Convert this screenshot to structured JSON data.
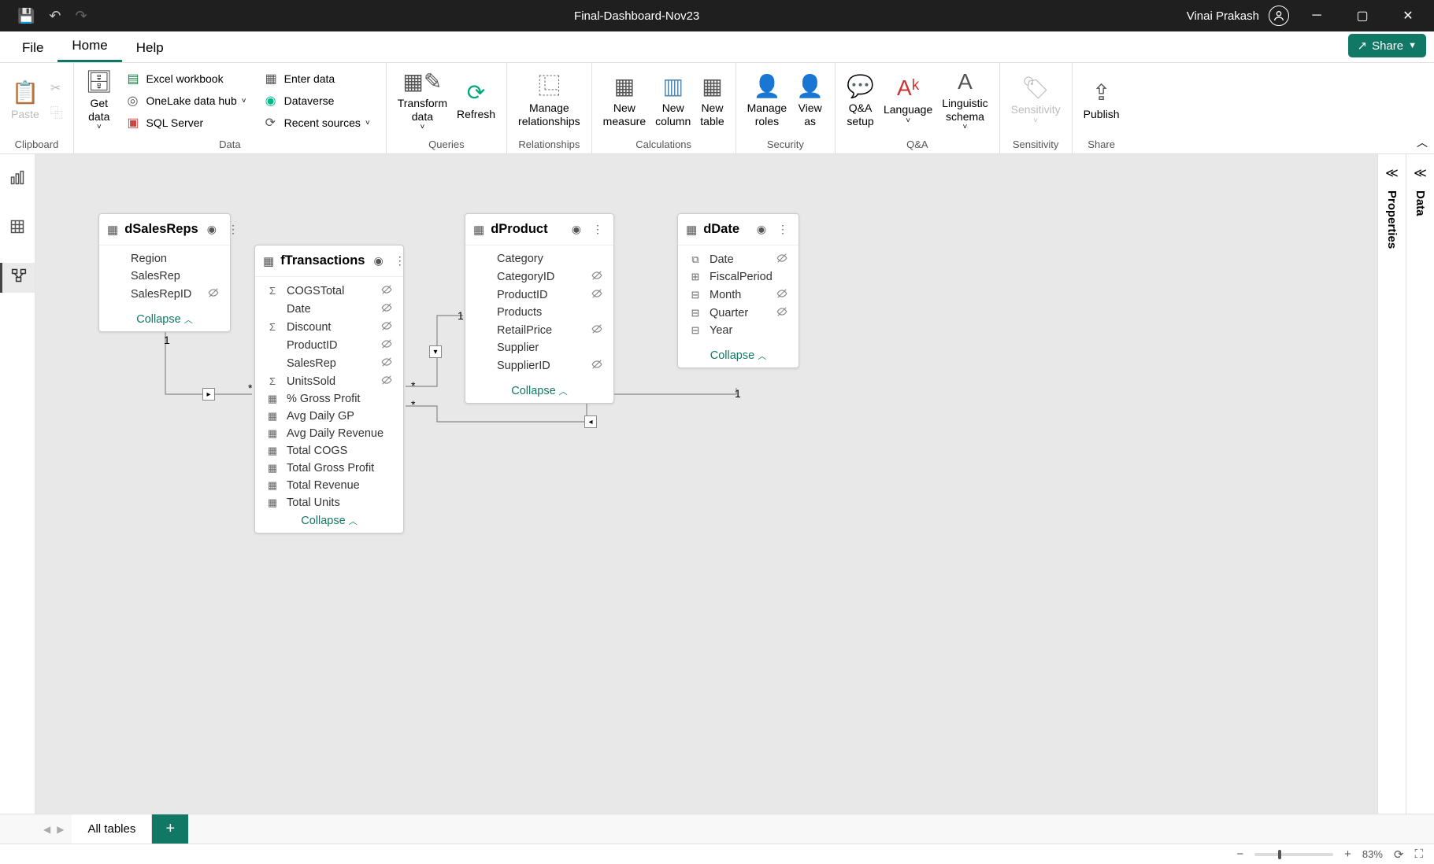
{
  "titlebar": {
    "title": "Final-Dashboard-Nov23",
    "user": "Vinai Prakash"
  },
  "menu": {
    "file": "File",
    "home": "Home",
    "help": "Help",
    "share": "Share"
  },
  "ribbon": {
    "clipboard": {
      "paste": "Paste",
      "label": "Clipboard"
    },
    "data": {
      "getdata": "Get\ndata",
      "excel": "Excel workbook",
      "onelake": "OneLake data hub",
      "sql": "SQL Server",
      "enterdata": "Enter data",
      "dataverse": "Dataverse",
      "recent": "Recent sources",
      "label": "Data"
    },
    "queries": {
      "transform": "Transform\ndata",
      "refresh": "Refresh",
      "label": "Queries"
    },
    "relationships": {
      "manage": "Manage\nrelationships",
      "label": "Relationships"
    },
    "calculations": {
      "measure": "New\nmeasure",
      "column": "New\ncolumn",
      "table": "New\ntable",
      "label": "Calculations"
    },
    "security": {
      "roles": "Manage\nroles",
      "viewas": "View\nas",
      "label": "Security"
    },
    "qa": {
      "setup": "Q&A\nsetup",
      "language": "Language",
      "schema": "Linguistic\nschema",
      "label": "Q&A"
    },
    "sensitivity": {
      "sens": "Sensitivity",
      "label": "Sensitivity"
    },
    "share": {
      "publish": "Publish",
      "label": "Share"
    }
  },
  "panels": {
    "data": "Data",
    "properties": "Properties"
  },
  "tables": {
    "dSalesReps": {
      "name": "dSalesReps",
      "fields": [
        {
          "name": "Region",
          "icon": "",
          "hidden": false
        },
        {
          "name": "SalesRep",
          "icon": "",
          "hidden": false
        },
        {
          "name": "SalesRepID",
          "icon": "",
          "hidden": true
        }
      ],
      "collapse": "Collapse"
    },
    "fTransactions": {
      "name": "fTransactions",
      "fields": [
        {
          "name": "COGSTotal",
          "icon": "Σ",
          "hidden": true
        },
        {
          "name": "Date",
          "icon": "",
          "hidden": true
        },
        {
          "name": "Discount",
          "icon": "Σ",
          "hidden": true
        },
        {
          "name": "ProductID",
          "icon": "",
          "hidden": true
        },
        {
          "name": "SalesRep",
          "icon": "",
          "hidden": true
        },
        {
          "name": "UnitsSold",
          "icon": "Σ",
          "hidden": true
        },
        {
          "name": "% Gross Profit",
          "icon": "▦",
          "hidden": false
        },
        {
          "name": "Avg Daily GP",
          "icon": "▦",
          "hidden": false
        },
        {
          "name": "Avg Daily Revenue",
          "icon": "▦",
          "hidden": false
        },
        {
          "name": "Total COGS",
          "icon": "▦",
          "hidden": false
        },
        {
          "name": "Total Gross Profit",
          "icon": "▦",
          "hidden": false
        },
        {
          "name": "Total Revenue",
          "icon": "▦",
          "hidden": false
        },
        {
          "name": "Total Units",
          "icon": "▦",
          "hidden": false
        }
      ],
      "collapse": "Collapse"
    },
    "dProduct": {
      "name": "dProduct",
      "fields": [
        {
          "name": "Category",
          "icon": "",
          "hidden": false
        },
        {
          "name": "CategoryID",
          "icon": "",
          "hidden": true
        },
        {
          "name": "ProductID",
          "icon": "",
          "hidden": true
        },
        {
          "name": "Products",
          "icon": "",
          "hidden": false
        },
        {
          "name": "RetailPrice",
          "icon": "",
          "hidden": true
        },
        {
          "name": "Supplier",
          "icon": "",
          "hidden": false
        },
        {
          "name": "SupplierID",
          "icon": "",
          "hidden": true
        }
      ],
      "collapse": "Collapse"
    },
    "dDate": {
      "name": "dDate",
      "fields": [
        {
          "name": "Date",
          "icon": "⧉",
          "hidden": true
        },
        {
          "name": "FiscalPeriod",
          "icon": "⊞",
          "hidden": false
        },
        {
          "name": "Month",
          "icon": "⊟",
          "hidden": true
        },
        {
          "name": "Quarter",
          "icon": "⊟",
          "hidden": true
        },
        {
          "name": "Year",
          "icon": "⊟",
          "hidden": false
        }
      ],
      "collapse": "Collapse"
    }
  },
  "bottomtabs": {
    "alltables": "All tables"
  },
  "statusbar": {
    "zoom": "83%"
  }
}
